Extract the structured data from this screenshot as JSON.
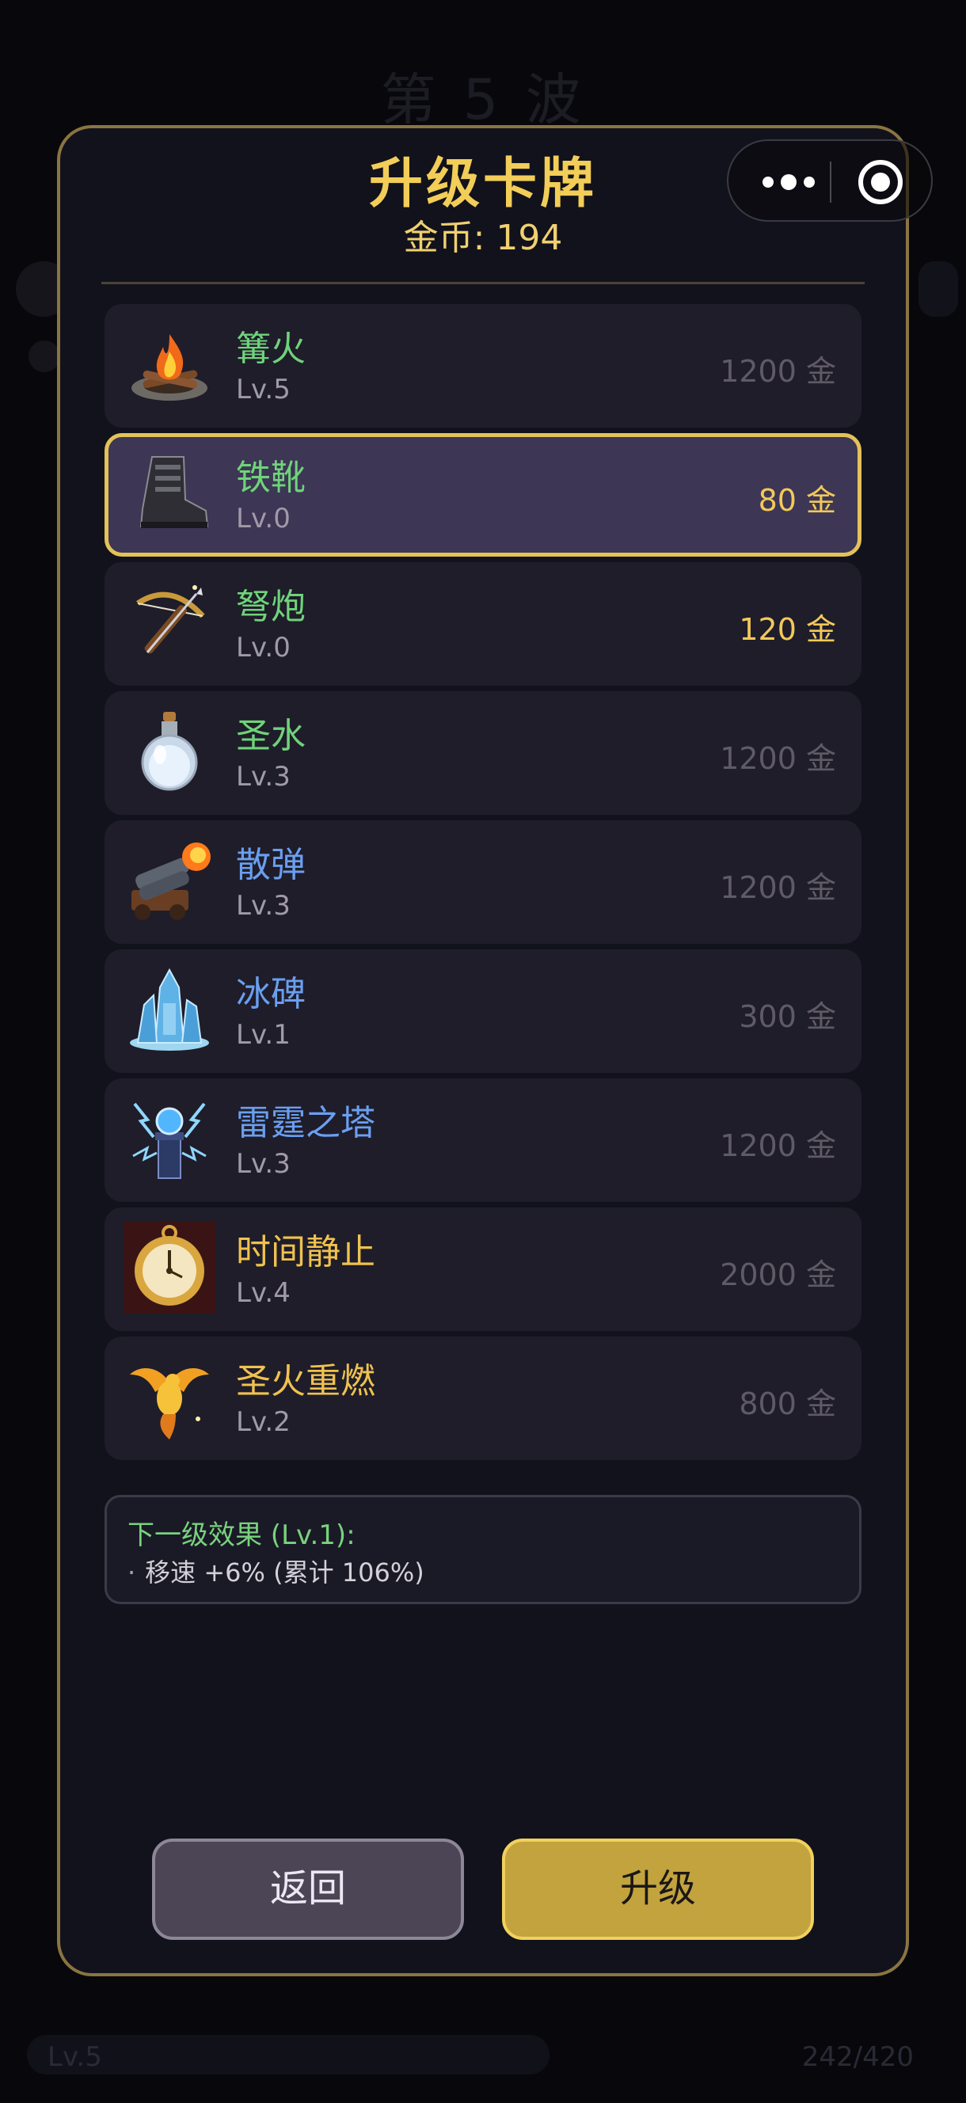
{
  "background": {
    "wave_label": "第 5 波",
    "player_level": "Lv.5",
    "xp_text": "242/420"
  },
  "dialog": {
    "title": "升级卡牌",
    "coins_label": "金币:",
    "coins_value": "194"
  },
  "cards": [
    {
      "name": "篝火",
      "level": "Lv.5",
      "price": "1200 金",
      "icon": "campfire-icon",
      "color_class": "green",
      "selected": false,
      "affordable": false
    },
    {
      "name": "铁靴",
      "level": "Lv.0",
      "price": "80 金",
      "icon": "iron-boots-icon",
      "color_class": "green",
      "selected": true,
      "affordable": true
    },
    {
      "name": "弩炮",
      "level": "Lv.0",
      "price": "120 金",
      "icon": "crossbow-icon",
      "color_class": "green",
      "selected": false,
      "affordable": true
    },
    {
      "name": "圣水",
      "level": "Lv.3",
      "price": "1200 金",
      "icon": "holy-water-icon",
      "color_class": "green",
      "selected": false,
      "affordable": false
    },
    {
      "name": "散弹",
      "level": "Lv.3",
      "price": "1200 金",
      "icon": "cannon-icon",
      "color_class": "blue",
      "selected": false,
      "affordable": false
    },
    {
      "name": "冰碑",
      "level": "Lv.1",
      "price": "300 金",
      "icon": "ice-monument-icon",
      "color_class": "blue",
      "selected": false,
      "affordable": false
    },
    {
      "name": "雷霆之塔",
      "level": "Lv.3",
      "price": "1200 金",
      "icon": "thunder-tower-icon",
      "color_class": "blue",
      "selected": false,
      "affordable": false
    },
    {
      "name": "时间静止",
      "level": "Lv.4",
      "price": "2000 金",
      "icon": "pocket-watch-icon",
      "color_class": "gold",
      "selected": false,
      "affordable": false
    },
    {
      "name": "圣火重燃",
      "level": "Lv.2",
      "price": "800 金",
      "icon": "phoenix-icon",
      "color_class": "gold",
      "selected": false,
      "affordable": false
    }
  ],
  "info": {
    "title": "下一级效果 (Lv.1):",
    "bullet": "·",
    "line": "移速 +6% (累计 106%)"
  },
  "buttons": {
    "back": "返回",
    "upgrade": "升级"
  },
  "colors": {
    "accent_gold": "#f2cd58",
    "green_name": "#6fd37a",
    "blue_name": "#6a9ff0",
    "gold_name": "#f0c24e",
    "selected_border": "#e3c258"
  }
}
